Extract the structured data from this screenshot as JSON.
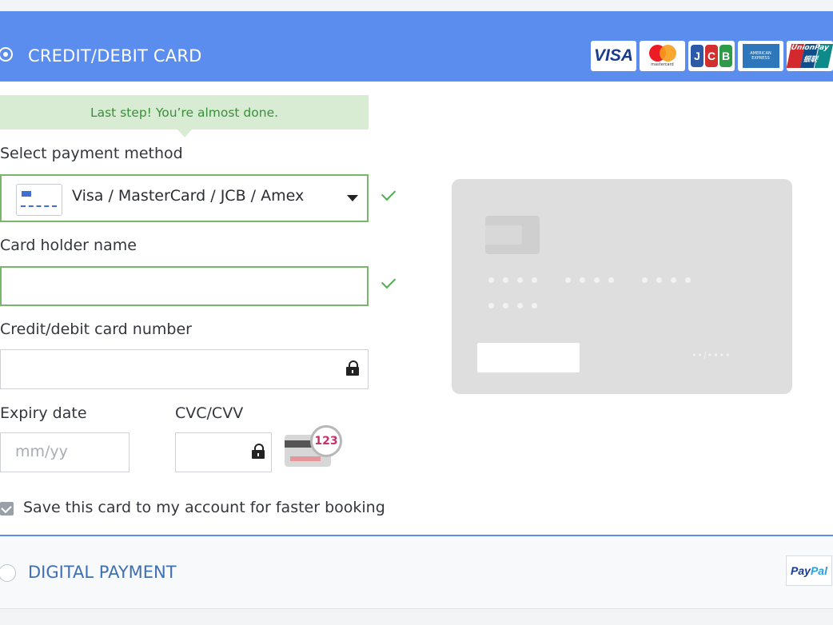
{
  "header": {
    "title": "CREDIT/DEBIT CARD",
    "logos": [
      {
        "name": "visa-logo",
        "text": "VISA"
      },
      {
        "name": "mastercard-logo",
        "text": "mastercard"
      },
      {
        "name": "jcb-logo",
        "letters": [
          "J",
          "C",
          "B"
        ],
        "colors": [
          "#2d5aa8",
          "#d32f2f",
          "#2e9b48"
        ]
      },
      {
        "name": "amex-logo",
        "text": "AMERICAN EXPRESS"
      },
      {
        "name": "unionpay-logo",
        "text": "UnionPay",
        "subtext": "银联",
        "colors": [
          "#d2282e",
          "#0f4d8c",
          "#0e8a8a"
        ]
      }
    ],
    "bg_color": "#5b8def"
  },
  "tip": {
    "text": "Last step! You’re almost done."
  },
  "form": {
    "payment_method": {
      "label": "Select payment method",
      "value": "Visa / MasterCard / JCB / Amex"
    },
    "holder_name": {
      "label": "Card holder name",
      "value": ""
    },
    "card_number": {
      "label": "Credit/debit card number",
      "value": ""
    },
    "expiry": {
      "label": "Expiry date",
      "placeholder": "mm/yy"
    },
    "cvc": {
      "label": "CVC/CVV",
      "value": "",
      "hint_number": "123"
    },
    "save_card": {
      "label": "Save this card to my account for faster booking",
      "checked": true
    }
  },
  "card_preview": {
    "expiry_mask": "••/••••"
  },
  "digital": {
    "title": "DIGITAL PAYMENT",
    "paypal_part1": "Pay",
    "paypal_part2": "Pal"
  },
  "colors": {
    "accent": "#5b8def",
    "valid": "#79b66c",
    "tip_bg": "#d7ecd2",
    "tip_text": "#3a8f3a"
  }
}
